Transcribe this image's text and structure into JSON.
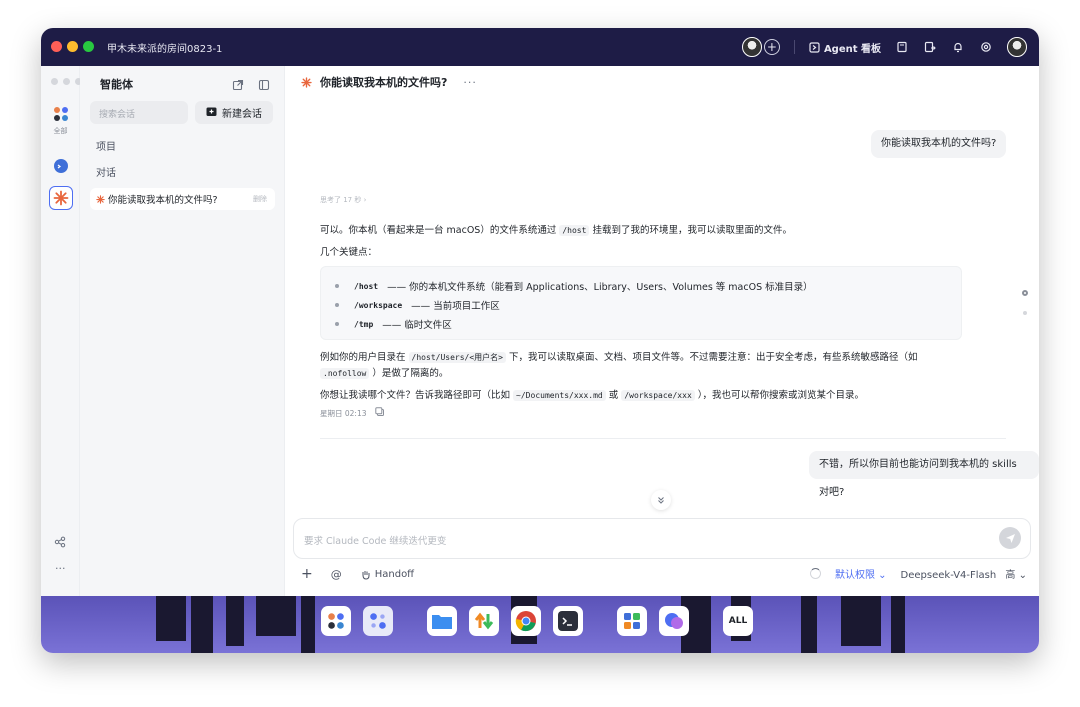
{
  "window": {
    "room_title": "甲木未来派的房间0823-1"
  },
  "topbar": {
    "agent_label": "Agent 看板"
  },
  "rail": {
    "all_label": "全部"
  },
  "sidebar": {
    "title": "智能体",
    "search_placeholder": "搜索会话",
    "new_chat_label": "新建会话",
    "section_projects": "项目",
    "section_chats": "对话",
    "conversation_title": "你能读取我本机的文件吗?",
    "conversation_action": "删除"
  },
  "main": {
    "header_title": "你能读取我本机的文件吗?",
    "header_more": "···",
    "user_msg_1": "你能读取我本机的文件吗?",
    "thinking_meta": "思考了 17 秒 ›",
    "reply_line_1_a": "可以。你本机（看起来是一台 macOS）的文件系统通过",
    "reply_line_1_code": "/host",
    "reply_line_1_b": "挂载到了我的环境里，我可以读取里面的文件。",
    "key_points_label": "几个关键点：",
    "key_points": [
      {
        "code": "/host",
        "text": "—— 你的本机文件系统（能看到 Applications、Library、Users、Volumes 等 macOS 标准目录）"
      },
      {
        "code": "/workspace",
        "text": "—— 当前项目工作区"
      },
      {
        "code": "/tmp",
        "text": "—— 临时文件区"
      }
    ],
    "reply_para_a": "例如你的用户目录在",
    "reply_para_code1": "/host/Users/<用户名>",
    "reply_para_b": "下，我可以读取桌面、文档、项目文件等。不过需要注意：出于安全考虑，有些系统敏感路径（如",
    "reply_para_code2": ".nofollow",
    "reply_para_c": "）是做了隔离的。",
    "reply_ask_a": "你想让我读哪个文件？告诉我路径即可（比如",
    "reply_ask_code1": "~/Documents/xxx.md",
    "reply_ask_b": "或",
    "reply_ask_code2": "/workspace/xxx",
    "reply_ask_c": "），我也可以帮你搜索或浏览某个目录。",
    "reply_time": "星期日 02:13",
    "user_msg_2": "不错，所以你目前也能访问到我本机的 skills 对吧?",
    "input_placeholder": "要求 Claude Code 继续迭代更变",
    "handoff_label": "Handoff",
    "permission_label": "默认权限",
    "model_label": "Deepseek-V4-Flash",
    "level_label": "高"
  },
  "dock": {
    "all_label": "ALL"
  }
}
